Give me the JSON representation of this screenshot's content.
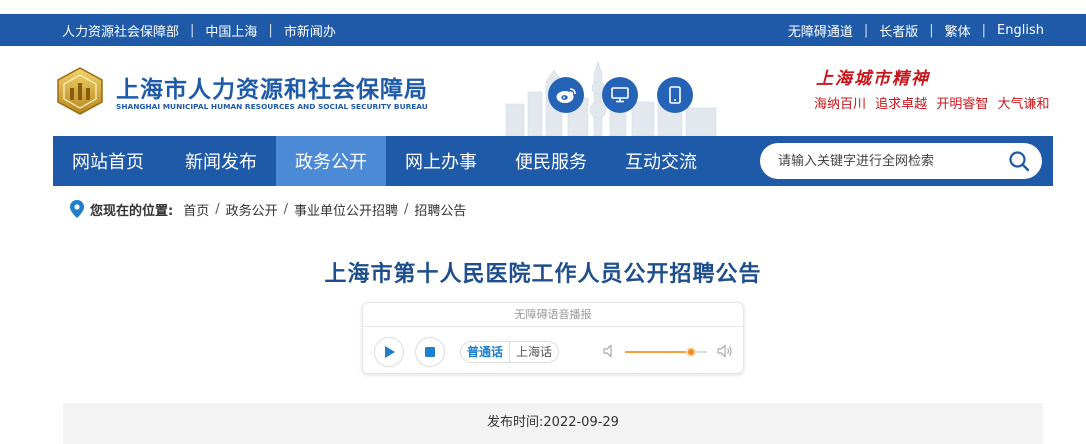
{
  "topbar": {
    "left_links": [
      "人力资源社会保障部",
      "中国上海",
      "市新闻办"
    ],
    "right_links": [
      "无障碍通道",
      "长者版",
      "繁体",
      "English"
    ]
  },
  "header": {
    "title_cn": "上海市人力资源和社会保障局",
    "title_en": "SHANGHAI MUNICIPAL HUMAN RESOURCES AND SOCIAL SECURITY BUREAU",
    "spirit_title": "上海城市精神",
    "spirit_words": [
      "海纳百川",
      "追求卓越",
      "开明睿智",
      "大气谦和"
    ],
    "icons": [
      "weibo-icon",
      "desktop-icon",
      "mobile-icon"
    ]
  },
  "nav": {
    "items": [
      "网站首页",
      "新闻发布",
      "政务公开",
      "网上办事",
      "便民服务",
      "互动交流"
    ],
    "active_index": 2,
    "search_placeholder": "请输入关键字进行全网检索"
  },
  "breadcrumb": {
    "label": "您现在的位置:",
    "crumbs": [
      "首页",
      "政务公开",
      "事业单位公开招聘",
      "招聘公告"
    ]
  },
  "article": {
    "title": "上海市第十人民医院工作人员公开招聘公告",
    "publish_label": "发布时间:",
    "publish_date": "2022-09-29"
  },
  "player": {
    "title": "无障碍语音播报",
    "languages": [
      "普通话",
      "上海话"
    ],
    "selected_language": "普通话",
    "volume": 0.8
  },
  "colors": {
    "brand_blue": "#1e5aa8",
    "nav_active": "#4d8ad6",
    "spirit_red": "#c8161d",
    "title_blue": "#1e4f8d",
    "volume_orange": "#f08a1a"
  }
}
